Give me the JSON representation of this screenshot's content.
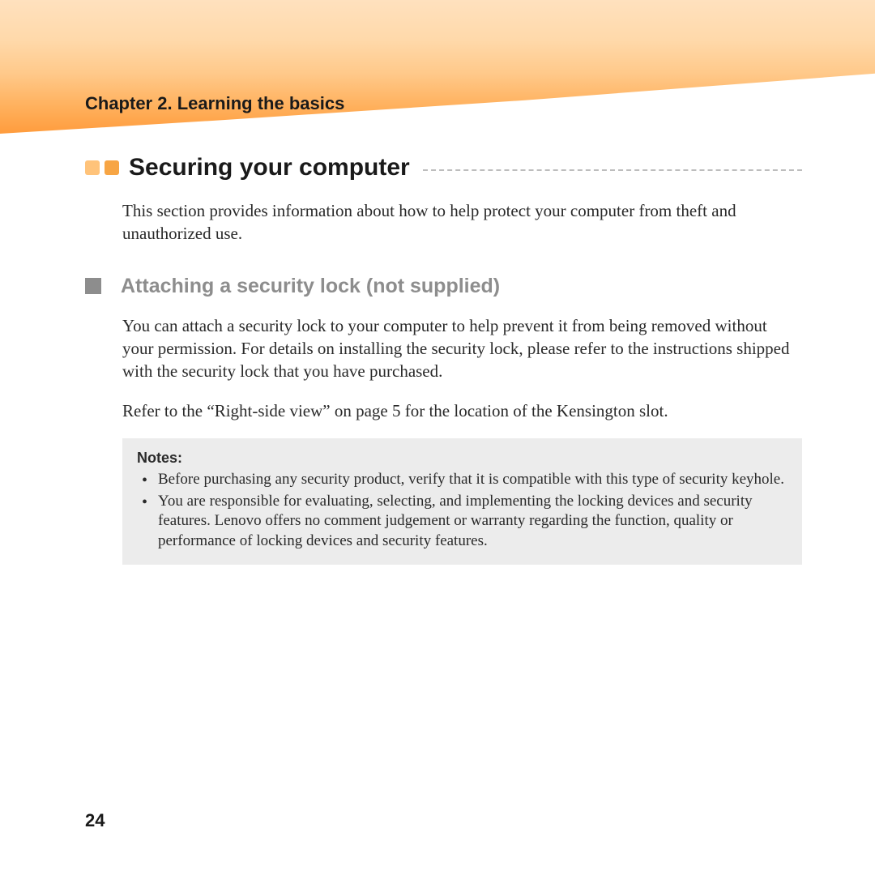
{
  "chapter": "Chapter 2. Learning the basics",
  "section": {
    "title": "Securing your computer",
    "intro": "This section provides information about how to help protect your computer from theft and unauthorized use."
  },
  "subsection": {
    "title": "Attaching a security lock (not supplied)",
    "paragraphs": [
      "You can attach a security lock to your computer to help prevent it from being removed without your permission. For details on installing the security lock, please refer to the instructions shipped with the security lock that you have purchased.",
      "Refer to the “Right-side view” on page 5 for the location of the Kensington slot."
    ]
  },
  "notes": {
    "label": "Notes:",
    "items": [
      "Before purchasing any security product, verify that it is compatible with this type of security keyhole.",
      "You are responsible for evaluating, selecting, and implementing the locking devices and security features. Lenovo offers no comment judgement or warranty regarding the function, quality or performance of locking devices and security features."
    ]
  },
  "page_number": "24"
}
